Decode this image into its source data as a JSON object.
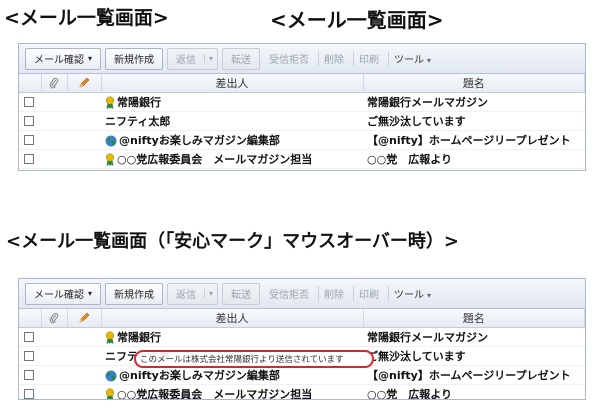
{
  "headings": {
    "first_small": "<メール一覧画面>",
    "first_large": "<メール一覧画面>",
    "second": "<メール一覧画面（「安心マーク」マウスオーバー時）>"
  },
  "toolbar": {
    "check_mail": "メール確認",
    "new_mail": "新規作成",
    "reply": "返信",
    "forward": "転送",
    "block": "受信拒否",
    "delete": "削除",
    "print": "印刷",
    "tools": "ツール"
  },
  "columns": {
    "from": "差出人",
    "subject": "題名"
  },
  "messages": [
    {
      "from": "常陽銀行",
      "subject": "常陽銀行メールマガジン",
      "icon": "ribbon-icon"
    },
    {
      "from": "ニフティ太郎",
      "subject": "ご無沙汰しています",
      "icon": ""
    },
    {
      "from": "@niftyお楽しみマガジン編集部",
      "subject": "【@nifty】ホームページリープレゼント",
      "icon": "globe-icon"
    },
    {
      "from": "○○党広報委員会　メールマガジン担当",
      "subject": "○○党　広報より",
      "icon": "ribbon-icon"
    }
  ],
  "tooltip_text": "このメールは株式会社常陽銀行より送信されています",
  "colors": {
    "highlight": "#d9262e",
    "ribbon": "#e8b800",
    "globe": "#2a8a3c"
  }
}
